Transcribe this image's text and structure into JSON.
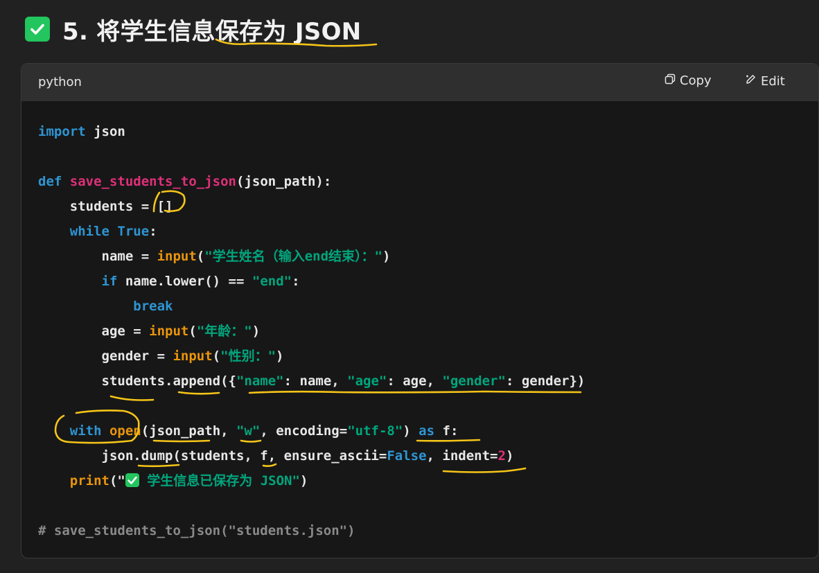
{
  "heading": {
    "text": "5. 将学生信息保存为 JSON",
    "icon": "check-icon",
    "icon_color": "#22c55e"
  },
  "code_block": {
    "language": "python",
    "copy_label": "Copy",
    "edit_label": "Edit",
    "lines": [
      [
        {
          "t": "import",
          "c": "kw"
        },
        {
          "t": " json"
        }
      ],
      [],
      [
        {
          "t": "def",
          "c": "kw"
        },
        {
          "t": " "
        },
        {
          "t": "save_students_to_json",
          "c": "fn"
        },
        {
          "t": "(json_path):"
        }
      ],
      [
        {
          "t": "    students = []"
        }
      ],
      [
        {
          "t": "    "
        },
        {
          "t": "while",
          "c": "kw"
        },
        {
          "t": " "
        },
        {
          "t": "True",
          "c": "kw"
        },
        {
          "t": ":"
        }
      ],
      [
        {
          "t": "        name = "
        },
        {
          "t": "input",
          "c": "bi"
        },
        {
          "t": "("
        },
        {
          "t": "\"学生姓名（输入end结束）：\"",
          "c": "st"
        },
        {
          "t": ")"
        }
      ],
      [
        {
          "t": "        "
        },
        {
          "t": "if",
          "c": "kw"
        },
        {
          "t": " name.lower() == "
        },
        {
          "t": "\"end\"",
          "c": "st"
        },
        {
          "t": ":"
        }
      ],
      [
        {
          "t": "            "
        },
        {
          "t": "break",
          "c": "kw"
        }
      ],
      [
        {
          "t": "        age = "
        },
        {
          "t": "input",
          "c": "bi"
        },
        {
          "t": "("
        },
        {
          "t": "\"年龄：\"",
          "c": "st"
        },
        {
          "t": ")"
        }
      ],
      [
        {
          "t": "        gender = "
        },
        {
          "t": "input",
          "c": "bi"
        },
        {
          "t": "("
        },
        {
          "t": "\"性别：\"",
          "c": "st"
        },
        {
          "t": ")"
        }
      ],
      [
        {
          "t": "        students.append({"
        },
        {
          "t": "\"name\"",
          "c": "st"
        },
        {
          "t": ": name, "
        },
        {
          "t": "\"age\"",
          "c": "st"
        },
        {
          "t": ": age, "
        },
        {
          "t": "\"gender\"",
          "c": "st"
        },
        {
          "t": ": gender})"
        }
      ],
      [],
      [
        {
          "t": "    "
        },
        {
          "t": "with",
          "c": "kw"
        },
        {
          "t": " "
        },
        {
          "t": "open",
          "c": "bi"
        },
        {
          "t": "(json_path, "
        },
        {
          "t": "\"w\"",
          "c": "st"
        },
        {
          "t": ", encoding="
        },
        {
          "t": "\"utf-8\"",
          "c": "st"
        },
        {
          "t": ") "
        },
        {
          "t": "as",
          "c": "kw"
        },
        {
          "t": " f:"
        }
      ],
      [
        {
          "t": "        json.dump(students, f, ensure_ascii="
        },
        {
          "t": "False",
          "c": "kw"
        },
        {
          "t": ", indent="
        },
        {
          "t": "2",
          "c": "num"
        },
        {
          "t": ")"
        }
      ],
      [
        {
          "t": "    "
        },
        {
          "t": "print",
          "c": "bi"
        },
        {
          "t": "(\""
        },
        {
          "t": "✅",
          "c": "tick"
        },
        {
          "t": " 学生信息已保存为 JSON\"",
          "c": "st"
        },
        {
          "t": ")"
        }
      ],
      [],
      [
        {
          "t": "# save_students_to_json(\"students.json\")",
          "c": "cm"
        }
      ]
    ]
  },
  "colors": {
    "keyword": "#2e95d3",
    "function_name": "#df3079",
    "builtin": "#e9950c",
    "string": "#00a67d",
    "comment": "#8a8a8a",
    "annotation_ink": "#f5c518"
  }
}
